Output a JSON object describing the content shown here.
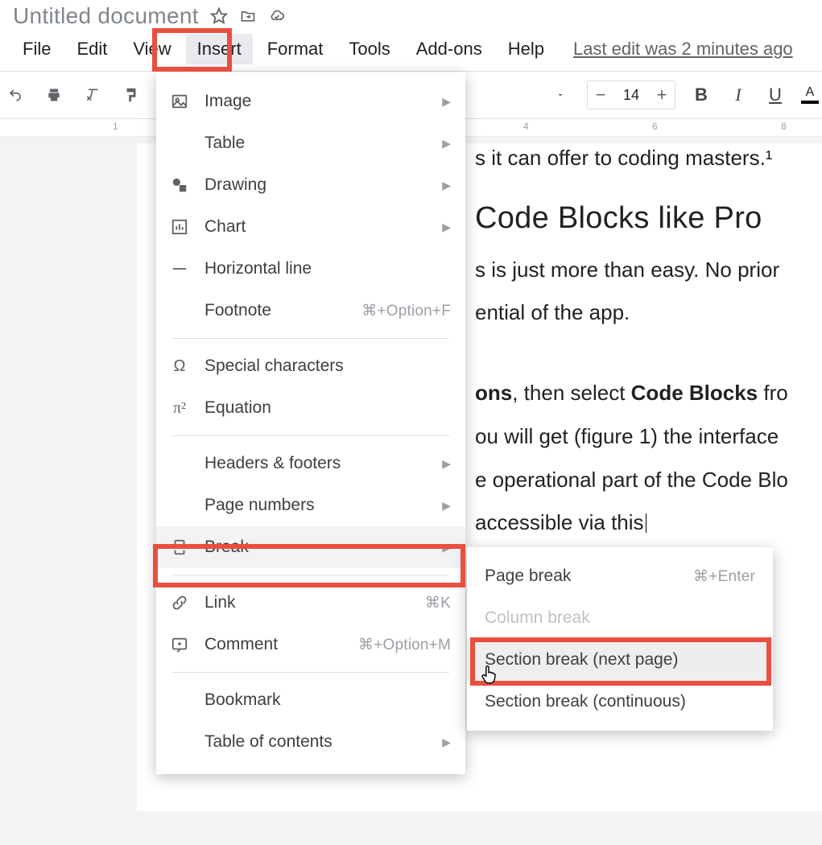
{
  "doc_title": "Untitled document",
  "menubar": [
    "File",
    "Edit",
    "View",
    "Insert",
    "Format",
    "Tools",
    "Add-ons",
    "Help"
  ],
  "open_menu": "Insert",
  "last_edit": "Last edit was 2 minutes ago",
  "toolbar": {
    "font_size": "14",
    "bold": "B",
    "italic": "I",
    "underline": "U",
    "text_color": "A"
  },
  "ruler": {
    "n1": "1",
    "n4": "4",
    "n6": "6",
    "n8": "8"
  },
  "document": {
    "l1": "s it can offer to coding masters.¹",
    "h1": "Code Blocks like Pro",
    "l2a": "s is just more than easy. No prior",
    "l2b": "ential of the app.",
    "l3a_1": "ons",
    "l3a_2": ", then select ",
    "l3a_3": "Code Blocks",
    "l3a_4": " fro",
    "l3b": "ou will get (figure 1) the interface",
    "l3c": "e operational part of the Code Blo",
    "l3d": "accessible via this"
  },
  "insert_menu": {
    "image": "Image",
    "table": "Table",
    "drawing": "Drawing",
    "chart": "Chart",
    "hline": "Horizontal line",
    "footnote": "Footnote",
    "footnote_sc": "⌘+Option+F",
    "special": "Special characters",
    "equation": "Equation",
    "headers": "Headers & footers",
    "pagenum": "Page numbers",
    "break": "Break",
    "link": "Link",
    "link_sc": "⌘K",
    "comment": "Comment",
    "comment_sc": "⌘+Option+M",
    "bookmark": "Bookmark",
    "toc": "Table of contents"
  },
  "break_submenu": {
    "page": "Page break",
    "page_sc": "⌘+Enter",
    "column": "Column break",
    "section_next": "Section break (next page)",
    "section_cont": "Section break (continuous)"
  }
}
